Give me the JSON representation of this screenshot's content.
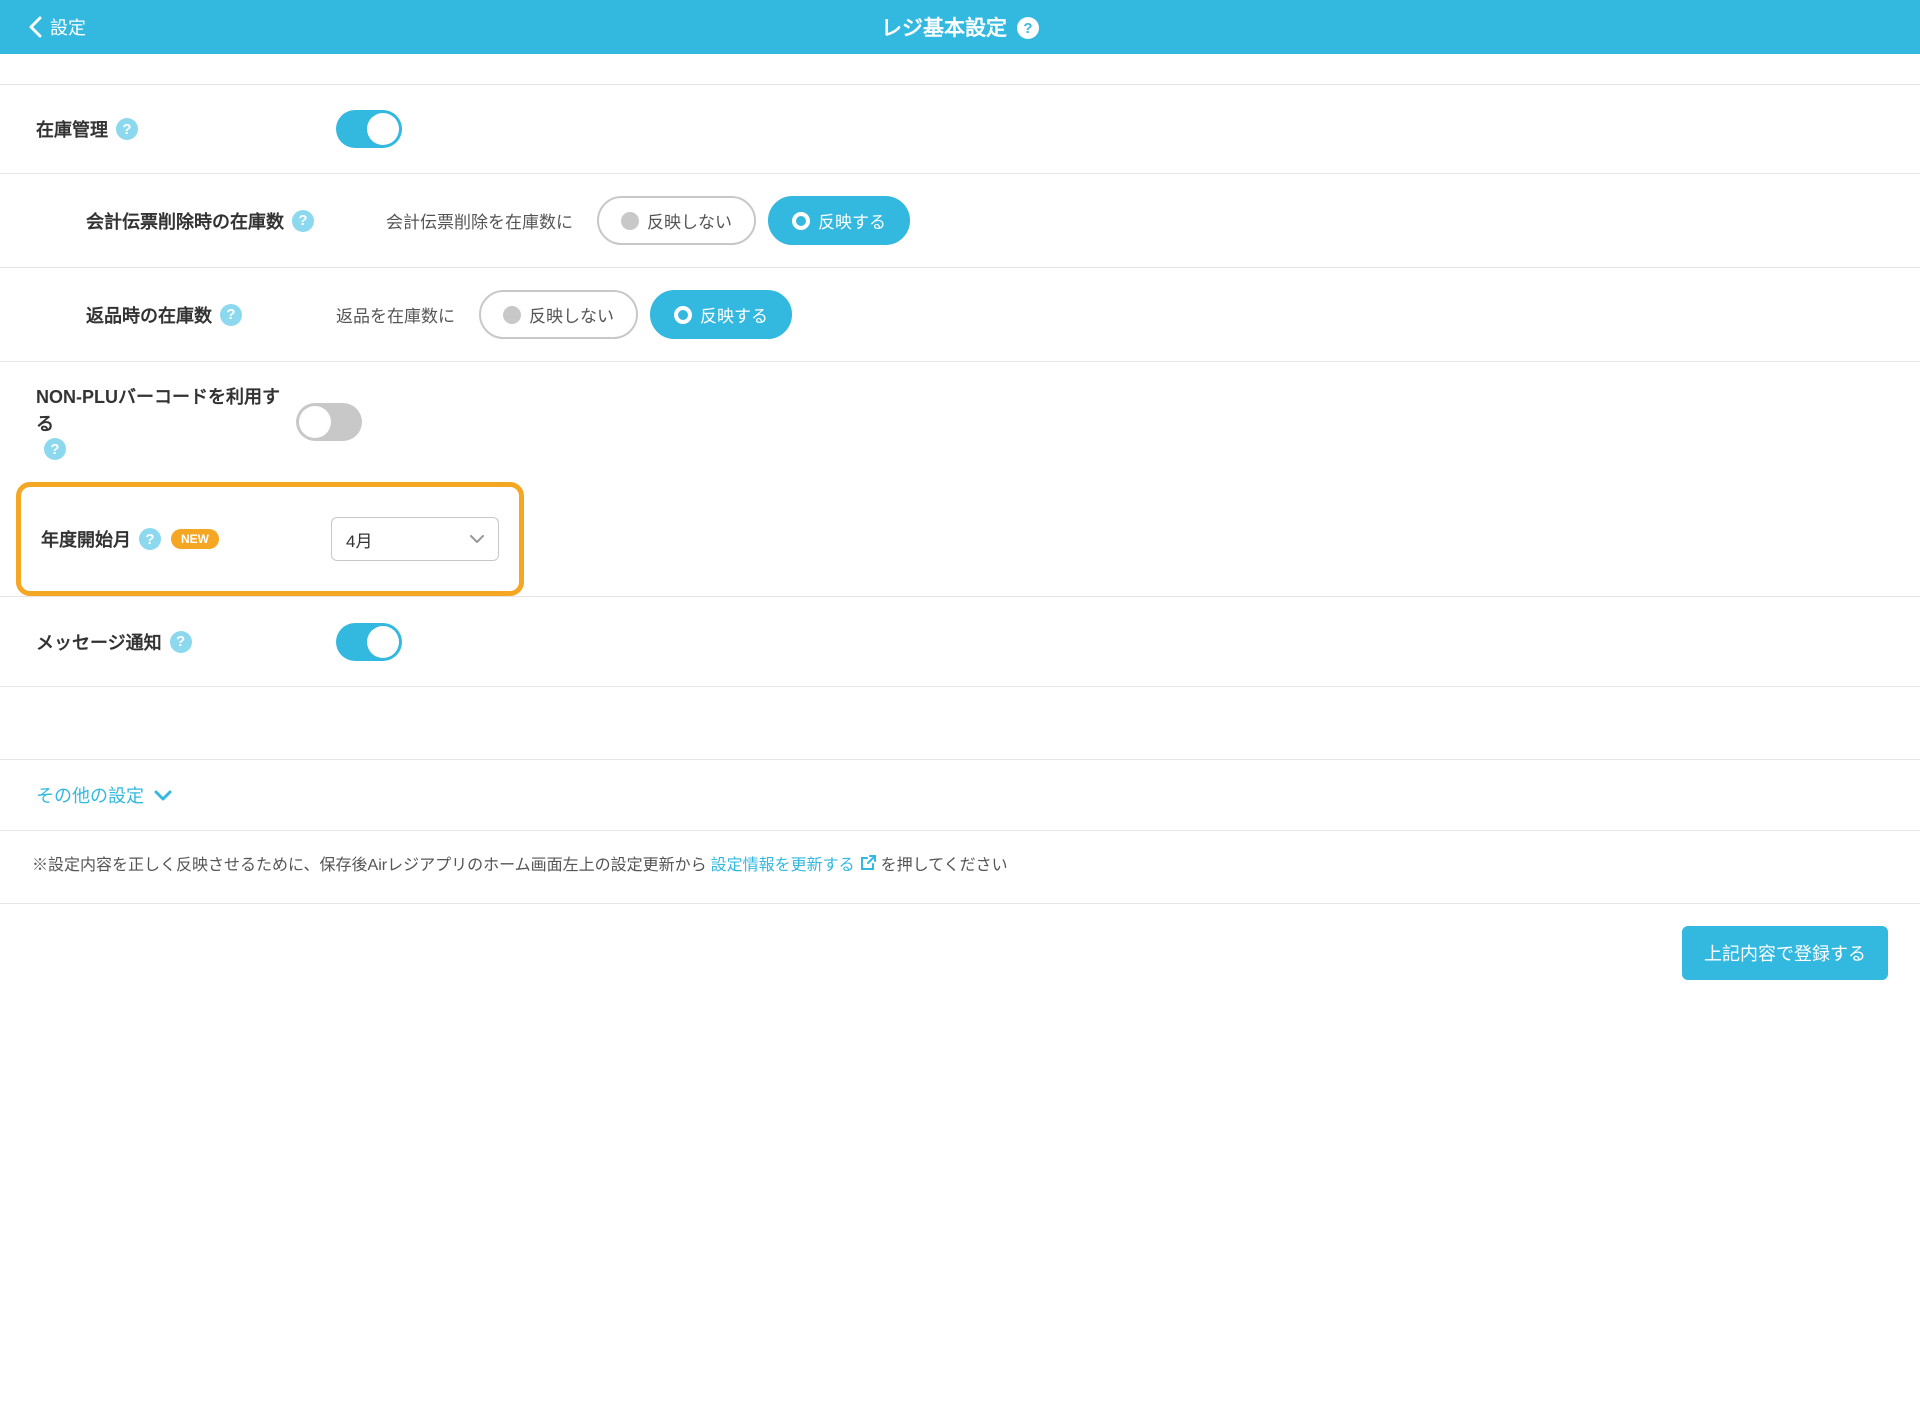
{
  "header": {
    "back_label": "設定",
    "title": "レジ基本設定"
  },
  "rows": {
    "inventory": {
      "label": "在庫管理",
      "toggle_on": true
    },
    "voucher_delete": {
      "label": "会計伝票削除時の在庫数",
      "desc": "会計伝票削除を在庫数に",
      "option_off": "反映しない",
      "option_on": "反映する"
    },
    "return_stock": {
      "label": "返品時の在庫数",
      "desc": "返品を在庫数に",
      "option_off": "反映しない",
      "option_on": "反映する"
    },
    "non_plu": {
      "label": "NON-PLUバーコードを利用する",
      "toggle_on": false
    },
    "fiscal_start": {
      "label": "年度開始月",
      "badge": "NEW",
      "selected": "4月"
    },
    "message_notify": {
      "label": "メッセージ通知",
      "toggle_on": true
    }
  },
  "other_settings_label": "その他の設定",
  "note": {
    "prefix": "※設定内容を正しく反映させるために、保存後Airレジアプリのホーム画面左上の設定更新から",
    "link": "設定情報を更新する",
    "suffix": "を押してください"
  },
  "submit_label": "上記内容で登録する"
}
